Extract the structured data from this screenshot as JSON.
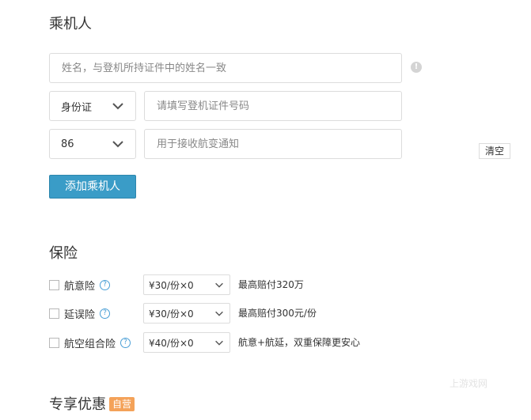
{
  "passenger": {
    "title": "乘机人",
    "name_placeholder": "姓名，与登机所持证件中的姓名一致",
    "id_type": "身份证",
    "id_placeholder": "请填写登机证件号码",
    "country_code": "86",
    "phone_placeholder": "用于接收航变通知",
    "add_label": "添加乘机人",
    "clear_label": "清空"
  },
  "insurance": {
    "title": "保险",
    "items": [
      {
        "label": "航意险",
        "price": "¥30/份×0",
        "desc": "最高赔付320万"
      },
      {
        "label": "延误险",
        "price": "¥30/份×0",
        "desc": "最高赔付300元/份"
      },
      {
        "label": "航空组合险",
        "price": "¥40/份×0",
        "desc": "航意+航延，双重保障更安心"
      }
    ]
  },
  "exclusive": {
    "title": "专享优惠",
    "badge": "自营"
  },
  "watermark": "上游戏网"
}
